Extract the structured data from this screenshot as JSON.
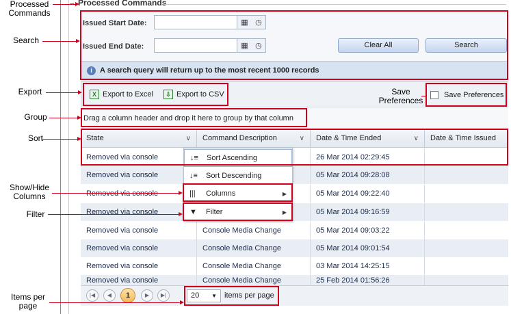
{
  "callouts": {
    "processed_commands": "Processed\nCommands",
    "search": "Search",
    "export": "Export",
    "group": "Group",
    "sort": "Sort",
    "show_hide_columns": "Show/Hide\nColumns",
    "filter": "Filter",
    "items_per_page": "Items per\npage",
    "save_preferences": "Save\nPreferences"
  },
  "section": {
    "toggle": "–",
    "title": "Processed Commands"
  },
  "search": {
    "start_label": "Issued Start Date:",
    "end_label": "Issued End Date:",
    "start_value": "",
    "end_value": "",
    "clear_label": "Clear All",
    "search_label": "Search",
    "info_text": "A search query will return up to the most recent 1000 records"
  },
  "toolbar": {
    "export_excel": "Export to Excel",
    "export_csv": "Export to CSV",
    "save_prefs": "Save Preferences"
  },
  "group_bar": {
    "text": "Drag a column header and drop it here to group by that column"
  },
  "columns": [
    "State",
    "Command Description",
    "Date & Time Ended",
    "Date & Time Issued"
  ],
  "rows": [
    [
      "Removed via console",
      "",
      "26 Mar 2014 02:29:45",
      ""
    ],
    [
      "Removed via console",
      "",
      "05 Mar 2014 09:28:08",
      ""
    ],
    [
      "Removed via console",
      "",
      "05 Mar 2014 09:22:40",
      ""
    ],
    [
      "Removed via console",
      "",
      "05 Mar 2014 09:16:59",
      ""
    ],
    [
      "Removed via console",
      "Console Media Change",
      "05 Mar 2014 09:03:22",
      ""
    ],
    [
      "Removed via console",
      "Console Media Change",
      "05 Mar 2014 09:01:54",
      ""
    ],
    [
      "Removed via console",
      "Console Media Change",
      "03 Mar 2014 14:25:15",
      ""
    ],
    [
      "Removed via console",
      "Console Media Change",
      "25 Feb 2014 01:56:26",
      ""
    ]
  ],
  "column_menu": {
    "sort_asc": "Sort Ascending",
    "sort_desc": "Sort Descending",
    "columns": "Columns",
    "filter": "Filter"
  },
  "pager": {
    "first": "|◀",
    "prev": "◀",
    "current": "1",
    "next": "▶",
    "last": "▶|",
    "page_size": "20",
    "items_label": "items per page"
  },
  "icons": {
    "calendar": "calendar-icon",
    "clock": "clock-icon",
    "info": "info-icon",
    "excel": "excel-icon",
    "csv": "csv-icon",
    "sort_asc": "sort-ascending-icon",
    "sort_desc": "sort-descending-icon",
    "columns": "columns-icon",
    "filter": "filter-icon"
  },
  "colors": {
    "callout_red": "#d0021b",
    "current_page": "#f2b95c",
    "header_blue": "#d8e3f1"
  }
}
